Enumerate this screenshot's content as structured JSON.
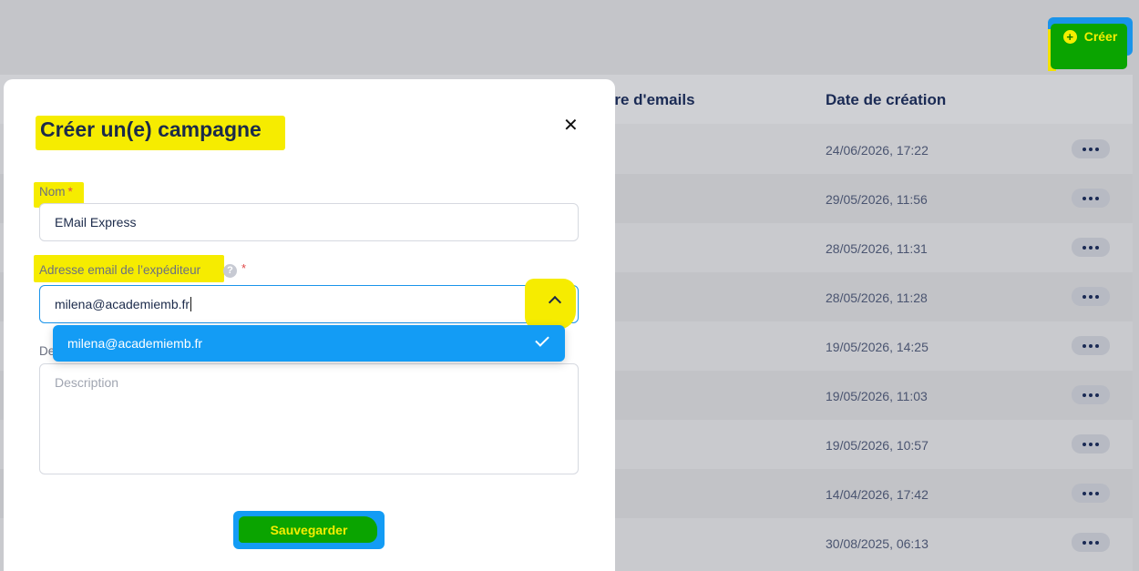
{
  "header": {
    "create_label": "Créer"
  },
  "table": {
    "columns": [
      "bre d'emails",
      "Date de création"
    ],
    "rows": [
      "24/06/2026, 17:22",
      "29/05/2026, 11:56",
      "28/05/2026, 11:31",
      "28/05/2026, 11:28",
      "19/05/2026, 14:25",
      "19/05/2026, 11:03",
      "19/05/2026, 10:57",
      "14/04/2026, 17:42",
      "30/08/2025, 06:13"
    ]
  },
  "modal": {
    "title": "Créer un(e) campagne",
    "close_icon": "✕",
    "name_label": "Nom",
    "name_value": "EMail Express",
    "sender_label": "Adresse email de l’expéditeur",
    "sender_value": "milena@academiemb.fr",
    "dropdown_option": "milena@academiemb.fr",
    "description_label": "De",
    "description_placeholder": "Description",
    "save_label": "Sauvegarder",
    "required_mark": "*",
    "help_mark": "?"
  }
}
